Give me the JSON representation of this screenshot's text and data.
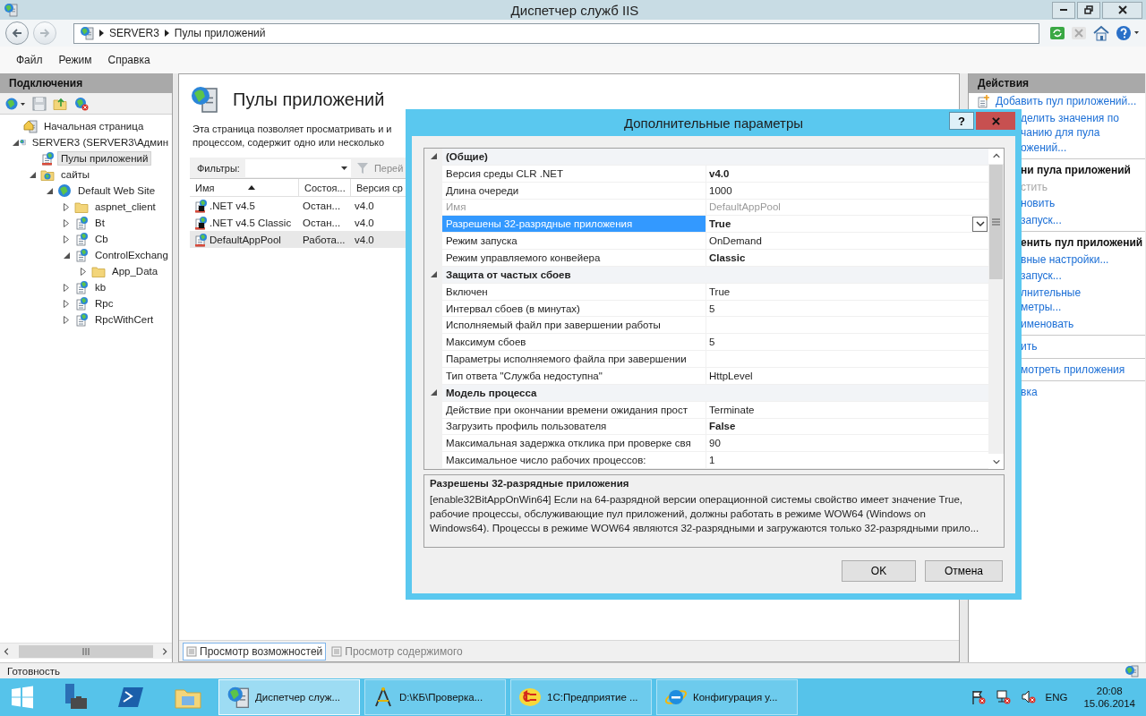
{
  "window": {
    "title": "Диспетчер служб IIS"
  },
  "address": {
    "segments": [
      "SERVER3",
      "Пулы приложений"
    ]
  },
  "menu": [
    "Файл",
    "Режим",
    "Справка"
  ],
  "connections": {
    "title": "Подключения",
    "tree": [
      {
        "kind": "home",
        "label": "Начальная страница",
        "leaf": true,
        "selected": false
      },
      {
        "kind": "server",
        "label": "SERVER3 (SERVER3\\Админ",
        "leaf": false,
        "expanded": true,
        "selected": false,
        "children": [
          {
            "kind": "pools",
            "label": "Пулы приложений",
            "leaf": true,
            "selected": true
          },
          {
            "kind": "sites",
            "label": "сайты",
            "leaf": false,
            "expanded": true,
            "selected": false,
            "children": [
              {
                "kind": "site",
                "label": "Default Web Site",
                "leaf": false,
                "expanded": true,
                "selected": false,
                "children": [
                  {
                    "kind": "folder",
                    "label": "aspnet_client",
                    "leaf": false,
                    "expanded": false,
                    "selected": false
                  },
                  {
                    "kind": "app",
                    "label": "Bt",
                    "leaf": false,
                    "expanded": false,
                    "selected": false
                  },
                  {
                    "kind": "app",
                    "label": "Cb",
                    "leaf": false,
                    "expanded": false,
                    "selected": false
                  },
                  {
                    "kind": "app",
                    "label": "ControlExchang",
                    "leaf": false,
                    "expanded": true,
                    "selected": false,
                    "children": [
                      {
                        "kind": "folder",
                        "label": "App_Data",
                        "leaf": false,
                        "expanded": false,
                        "selected": false
                      }
                    ]
                  },
                  {
                    "kind": "app",
                    "label": "kb",
                    "leaf": false,
                    "expanded": false,
                    "selected": false
                  },
                  {
                    "kind": "app",
                    "label": "Rpc",
                    "leaf": false,
                    "expanded": false,
                    "selected": false
                  },
                  {
                    "kind": "app",
                    "label": "RpcWithCert",
                    "leaf": false,
                    "expanded": false,
                    "selected": false
                  }
                ]
              }
            ]
          }
        ]
      }
    ]
  },
  "pools_page": {
    "title": "Пулы приложений",
    "description": [
      "Эта страница позволяет просматривать и и",
      "процессом, содержит одно или несколько"
    ],
    "filter": {
      "label": "Фильтры:",
      "go": "Перей"
    },
    "columns": [
      {
        "label": "Имя",
        "sorted": true
      },
      {
        "label": "Состоя...",
        "sorted": false
      },
      {
        "label": "Версия ср",
        "sorted": false
      }
    ],
    "rows": [
      {
        "name": ".NET v4.5",
        "state": "Остан...",
        "version": "v4.0",
        "running": false,
        "selected": false
      },
      {
        "name": ".NET v4.5 Classic",
        "state": "Остан...",
        "version": "v4.0",
        "running": false,
        "selected": false
      },
      {
        "name": "DefaultAppPool",
        "state": "Работа...",
        "version": "v4.0",
        "running": true,
        "selected": true
      }
    ],
    "view_tabs": [
      {
        "label": "Просмотр возможностей",
        "selected": true
      },
      {
        "label": "Просмотр содержимого",
        "selected": false
      }
    ]
  },
  "actions": {
    "title": "Действия",
    "groups": [
      {
        "items": [
          {
            "kind": "add",
            "text": "Добавить пул приложений..."
          },
          {
            "kind": "link",
            "text": "делить значения по\nчанию для пула\nожений..."
          }
        ]
      },
      {
        "items": [
          {
            "kind": "heading",
            "text": "ни пула приложений"
          },
          {
            "kind": "disabled",
            "text": "стить"
          },
          {
            "kind": "link",
            "text": "новить"
          },
          {
            "kind": "link",
            "text": "запуск..."
          }
        ]
      },
      {
        "items": [
          {
            "kind": "heading",
            "text": "енить пул приложений"
          },
          {
            "kind": "link",
            "text": "вные настройки..."
          },
          {
            "kind": "link",
            "text": "запуск..."
          },
          {
            "kind": "link",
            "text": "лнительные\nметры..."
          },
          {
            "kind": "link",
            "text": "именовать"
          }
        ]
      },
      {
        "items": [
          {
            "kind": "link",
            "text": "ить"
          }
        ]
      },
      {
        "items": [
          {
            "kind": "link",
            "text": "мотреть приложения"
          }
        ]
      },
      {
        "items": [
          {
            "kind": "link",
            "text": "вка"
          }
        ]
      }
    ]
  },
  "dialog": {
    "title": "Дополнительные параметры",
    "help": "?",
    "categories": [
      {
        "name": "(Общие)",
        "expanded": true,
        "properties": [
          {
            "name": "Версия среды CLR .NET",
            "value": "v4.0",
            "changed": true,
            "disabled": false,
            "selected": false
          },
          {
            "name": "Длина очереди",
            "value": "1000",
            "changed": false,
            "disabled": false,
            "selected": false
          },
          {
            "name": "Имя",
            "value": "DefaultAppPool",
            "changed": false,
            "disabled": true,
            "selected": false
          },
          {
            "name": "Разрешены 32-разрядные приложения",
            "value": "True",
            "changed": true,
            "disabled": false,
            "selected": true
          },
          {
            "name": "Режим запуска",
            "value": "OnDemand",
            "changed": false,
            "disabled": false,
            "selected": false
          },
          {
            "name": "Режим управляемого конвейера",
            "value": "Classic",
            "changed": true,
            "disabled": false,
            "selected": false
          }
        ]
      },
      {
        "name": "Защита от частых сбоев",
        "expanded": true,
        "properties": [
          {
            "name": "Включен",
            "value": "True",
            "changed": false,
            "disabled": false,
            "selected": false
          },
          {
            "name": "Интервал сбоев (в минутах)",
            "value": "5",
            "changed": false,
            "disabled": false,
            "selected": false
          },
          {
            "name": "Исполняемый файл при завершении работы",
            "disabled": false,
            "selected": false
          },
          {
            "name": "Максимум сбоев",
            "value": "5",
            "changed": false,
            "disabled": false,
            "selected": false
          },
          {
            "name": "Параметры исполняемого файла при завершении",
            "disabled": false,
            "selected": false
          },
          {
            "name": "Тип ответа \"Служба недоступна\"",
            "value": "HttpLevel",
            "changed": false,
            "disabled": false,
            "selected": false
          }
        ]
      },
      {
        "name": "Модель процесса",
        "expanded": true,
        "properties": [
          {
            "name": "Действие при окончании времени ожидания прост",
            "value": "Terminate",
            "changed": false,
            "disabled": false,
            "selected": false
          },
          {
            "name": "Загрузить профиль пользователя",
            "value": "False",
            "changed": true,
            "disabled": false,
            "selected": false
          },
          {
            "name": "Максимальная задержка отклика при проверке свя",
            "value": "90",
            "changed": false,
            "disabled": false,
            "selected": false
          },
          {
            "name": "Максимальное число рабочих процессов:",
            "value": "1",
            "changed": false,
            "disabled": false,
            "selected": false
          }
        ]
      }
    ],
    "description": {
      "title": "Разрешены 32-разрядные приложения",
      "text": "[enable32BitAppOnWin64] Если на 64-разрядной версии операционной системы свойство имеет значение True,\nрабочие процессы, обслуживающие пул приложений, должны работать в режиме WOW64 (Windows on\nWindows64). Процессы в режиме WOW64 являются 32-разрядными и загружаются только 32-разрядными прило..."
    },
    "buttons": [
      "OK",
      "Отмена"
    ]
  },
  "status_bar": {
    "text": "Готовность"
  },
  "taskbar": {
    "tasks": [
      {
        "kind": "iis",
        "label": "Диспетчер служ...",
        "selected": true
      },
      {
        "kind": "compass",
        "label": "D:\\КБ\\Проверка...",
        "selected": false
      },
      {
        "kind": "onec",
        "label": "1С:Предприятие ...",
        "selected": false
      },
      {
        "kind": "ie",
        "label": "Конфигурация у...",
        "selected": false
      }
    ],
    "language": "ENG",
    "time": "20:08",
    "date": "15.06.2014"
  }
}
